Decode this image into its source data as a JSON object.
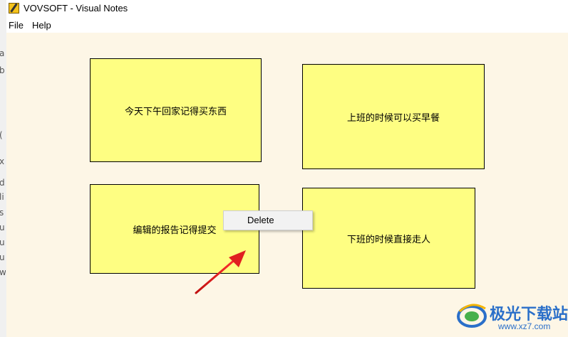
{
  "window": {
    "title": "VOVSOFT - Visual Notes",
    "icon": "sticky-note-app-icon"
  },
  "menu": {
    "items": [
      {
        "label": "File"
      },
      {
        "label": "Help"
      }
    ]
  },
  "notes": [
    {
      "text": "今天下午回家记得买东西"
    },
    {
      "text": "上班的时候可以买早餐"
    },
    {
      "text": "编辑的报告记得提交"
    },
    {
      "text": "下班的时候直接走人"
    }
  ],
  "context_menu": {
    "items": [
      {
        "label": "Delete"
      }
    ]
  },
  "annotation": {
    "icon": "red-arrow-icon",
    "color": "#e02020"
  },
  "watermark": {
    "brand": "极光下载站",
    "url": "www.xz7.com"
  },
  "background_window_chars": [
    "а",
    "b",
    "(",
    "x",
    "d",
    "li",
    "s",
    "u",
    "u",
    "u",
    "w"
  ],
  "colors": {
    "note_fill": "#fefe82",
    "canvas_bg": "#fdf6e6",
    "watermark_blue": "#2a6fc9"
  }
}
